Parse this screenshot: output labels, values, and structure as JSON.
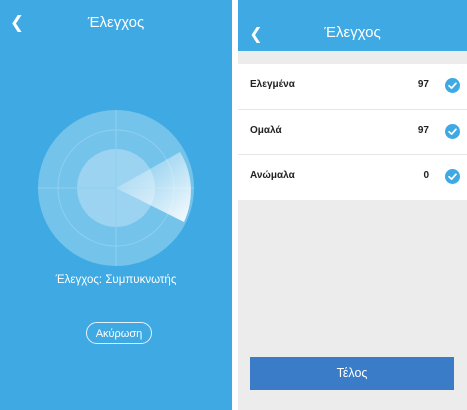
{
  "left_screen": {
    "header": {
      "back_icon": "chevron-left-icon",
      "title": "Έλεγχος"
    },
    "status_text": "Έλεγχος: Συμπυκνωτής",
    "cancel_label": "Ακύρωση",
    "colors": {
      "background": "#3ea9e3",
      "radar": "#74c3eb",
      "radar_center": "#9bd3f1"
    }
  },
  "right_screen": {
    "header": {
      "back_icon": "chevron-left-icon",
      "title": "Έλεγχος"
    },
    "items": [
      {
        "label": "Ελεγμένα",
        "count": "97",
        "icon": "check-circle-icon"
      },
      {
        "label": "Ομαλά",
        "count": "97",
        "icon": "check-circle-icon"
      },
      {
        "label": "Ανώμαλα",
        "count": "0",
        "icon": "check-circle-icon"
      }
    ],
    "done_label": "Τέλος",
    "colors": {
      "header": "#3ea9e3",
      "check": "#3ea9e3",
      "done_button": "#3a7cc7"
    }
  }
}
